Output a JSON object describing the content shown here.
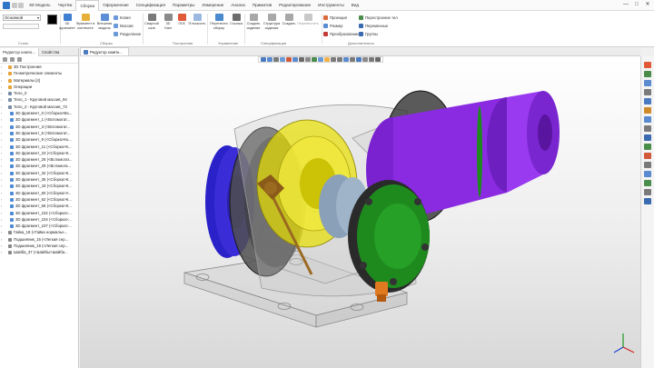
{
  "window": {
    "minimize": "—",
    "maximize": "□",
    "close": "✕"
  },
  "menu_tabs": [
    "3D Модель",
    "Чертёж",
    "Сборка",
    "Оформление",
    "Спецификация",
    "Параметры",
    "Измерение",
    "Анализ",
    "Примитив",
    "Редактирование",
    "Инструменты",
    "Вид"
  ],
  "ribbon": {
    "style_combo": "Основной",
    "groups": {
      "styles": "Стиль",
      "assembly": "Сборка",
      "construction": "Построения",
      "management": "Управление",
      "specification": "Спецификация",
      "extra": "Дополнительно"
    },
    "buttons": {
      "fragment_3d": "3D\nфрагмент",
      "fragment_external": "Фрагмент в\nконтексте",
      "fragment_model": "Внешняя\nмодель",
      "copy": "Копия",
      "array": "Массив",
      "split": "Разделение",
      "weld": "Сварной\nшов",
      "usk": "3D\nУзел",
      "lsk": "ЛСК",
      "plane": "Плоскость",
      "move": "Перенести\nсборку",
      "link": "Ссылка",
      "create_structure": "Создать\nизделие",
      "structure": "Структура\nизделия",
      "create": "Создать",
      "rearrange": "Переместить"
    },
    "extra_items": {
      "projection": "Проекция",
      "size": "Размер",
      "transform": "Преобразование",
      "recompute": "Перестроение тел",
      "variables": "Переменные",
      "groups": "Группы"
    }
  },
  "tree_panel": {
    "tabs": [
      "Редактор компо...",
      "Свойства"
    ],
    "items": [
      {
        "toggle": "",
        "label": "3D Построения",
        "color": "#e8a33a",
        "sub": false
      },
      {
        "toggle": "",
        "label": "Геометрические элементы",
        "color": "#e8a33a",
        "sub": false
      },
      {
        "toggle": "",
        "label": "Материалы [4]",
        "color": "#e8a33a",
        "sub": false
      },
      {
        "toggle": "",
        "label": "Операции",
        "color": "#e8a33a",
        "sub": false
      },
      {
        "toggle": "",
        "label": "Тело_0",
        "color": "#7a8da6",
        "sub": false
      },
      {
        "toggle": "",
        "label": "Тело_1 - Круговой массив_94",
        "color": "#7a8da6",
        "sub": false
      },
      {
        "toggle": "",
        "label": "Тело_2 - Круговой массив_73",
        "color": "#7a8da6",
        "sub": false
      },
      {
        "toggle": "",
        "label": "3D фрагмент_0 (<Сборка>Ва...",
        "color": "#4f8ad6",
        "sub": true
      },
      {
        "toggle": "",
        "label": "3D фрагмент_1 (<Вспомогат...",
        "color": "#4f8ad6",
        "sub": true
      },
      {
        "toggle": "",
        "label": "3D фрагмент_3 (<Вспомогат...",
        "color": "#4f8ad6",
        "sub": true
      },
      {
        "toggle": "",
        "label": "3D фрагмент_5 (<Вспомогат...",
        "color": "#4f8ad6",
        "sub": true
      },
      {
        "toggle": "",
        "label": "3D фрагмент_9 (<Сборка>Ко...",
        "color": "#4f8ad6",
        "sub": true
      },
      {
        "toggle": "",
        "label": "3D фрагмент_11 (<Сборка>К...",
        "color": "#4f8ad6",
        "sub": true
      },
      {
        "toggle": "",
        "label": "3D фрагмент_23 (<Сборка>К...",
        "color": "#4f8ad6",
        "sub": true
      },
      {
        "toggle": "",
        "label": "3D фрагмент_26 (<Вспомогат...",
        "color": "#4f8ad6",
        "sub": true
      },
      {
        "toggle": "",
        "label": "3D фрагмент_29 (<Вспомога...",
        "color": "#4f8ad6",
        "sub": true
      },
      {
        "toggle": "",
        "label": "3D фрагмент_32 (<Сборка>К...",
        "color": "#4f8ad6",
        "sub": true
      },
      {
        "toggle": "",
        "label": "3D фрагмент_35 (<Сборка>К...",
        "color": "#4f8ad6",
        "sub": true
      },
      {
        "toggle": "",
        "label": "3D фрагмент_43 (<Сборка>К...",
        "color": "#4f8ad6",
        "sub": true
      },
      {
        "toggle": "",
        "label": "3D фрагмент_60 (<Сборка>У...",
        "color": "#4f8ad6",
        "sub": true
      },
      {
        "toggle": "",
        "label": "3D фрагмент_62 (<Сборка>К...",
        "color": "#4f8ad6",
        "sub": true
      },
      {
        "toggle": "",
        "label": "3D фрагмент_66 (<Сборка>К...",
        "color": "#4f8ad6",
        "sub": true
      },
      {
        "toggle": "",
        "label": "3D фрагмент_102 (<Сборка>...",
        "color": "#4f8ad6",
        "sub": true
      },
      {
        "toggle": "",
        "label": "3D фрагмент_104 (<Сборка>...",
        "color": "#4f8ad6",
        "sub": true
      },
      {
        "toggle": "",
        "label": "3D фрагмент_107 (<Сборка>...",
        "color": "#4f8ad6",
        "sub": true
      },
      {
        "toggle": "",
        "label": "Гайка_18 (<Гайки нормальн...",
        "color": "#888888",
        "sub": false
      },
      {
        "toggle": "",
        "label": "Подшипник_15 (<Легкая сер...",
        "color": "#888888",
        "sub": false
      },
      {
        "toggle": "",
        "label": "Подшипник_19 (<Легкая сер...",
        "color": "#888888",
        "sub": false
      },
      {
        "toggle": "",
        "label": "Шайба_37 (<Шайбы>Шайба...",
        "color": "#888888",
        "sub": false
      }
    ]
  },
  "document_tab": "Редуктор компн...",
  "viewport": {
    "background_top": "#ffffff",
    "background_bottom": "#d8d8d8",
    "colors": {
      "housing": "#9a9a9a",
      "blue_coupling": "#3a2dd8",
      "purple_shaft": "#8a2be2",
      "yellow_gear": "#e8e000",
      "green_cover": "#1e8a1e",
      "dark_flange": "#2a2a2a",
      "brown_lever": "#9a6a20",
      "orange_bolt": "#e07a20"
    }
  }
}
